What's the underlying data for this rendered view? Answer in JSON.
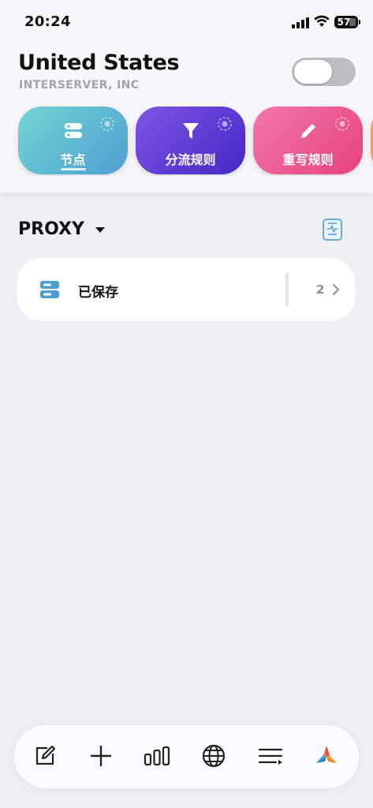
{
  "status_bar": {
    "time": "20:24",
    "battery": "57"
  },
  "header": {
    "title": "United States",
    "subtitle": "INTERSERVER, INC",
    "toggle_on": false
  },
  "tabs": [
    {
      "label": "节点",
      "icon": "server-icon",
      "colors": [
        "#6fd3d6",
        "#4a9ed0"
      ],
      "selected": true
    },
    {
      "label": "分流规则",
      "icon": "filter-icon",
      "colors": [
        "#7b4fe3",
        "#4a2fc9"
      ],
      "selected": false
    },
    {
      "label": "重写规则",
      "icon": "pencil-icon",
      "colors": [
        "#f06aa6",
        "#e8447f"
      ],
      "selected": false
    }
  ],
  "section": {
    "title": "PROXY",
    "icon": "log-icon"
  },
  "list": [
    {
      "label": "已保存",
      "count": "2",
      "icon": "server-icon"
    }
  ],
  "toolbar": {
    "items": [
      "edit-icon",
      "add-icon",
      "stats-icon",
      "globe-icon",
      "list-icon",
      "app-logo-icon"
    ]
  },
  "colors": {
    "accent_blue": "#4a9ed0",
    "background": "#efeef3",
    "toggle_off": "#bdbdc2"
  }
}
